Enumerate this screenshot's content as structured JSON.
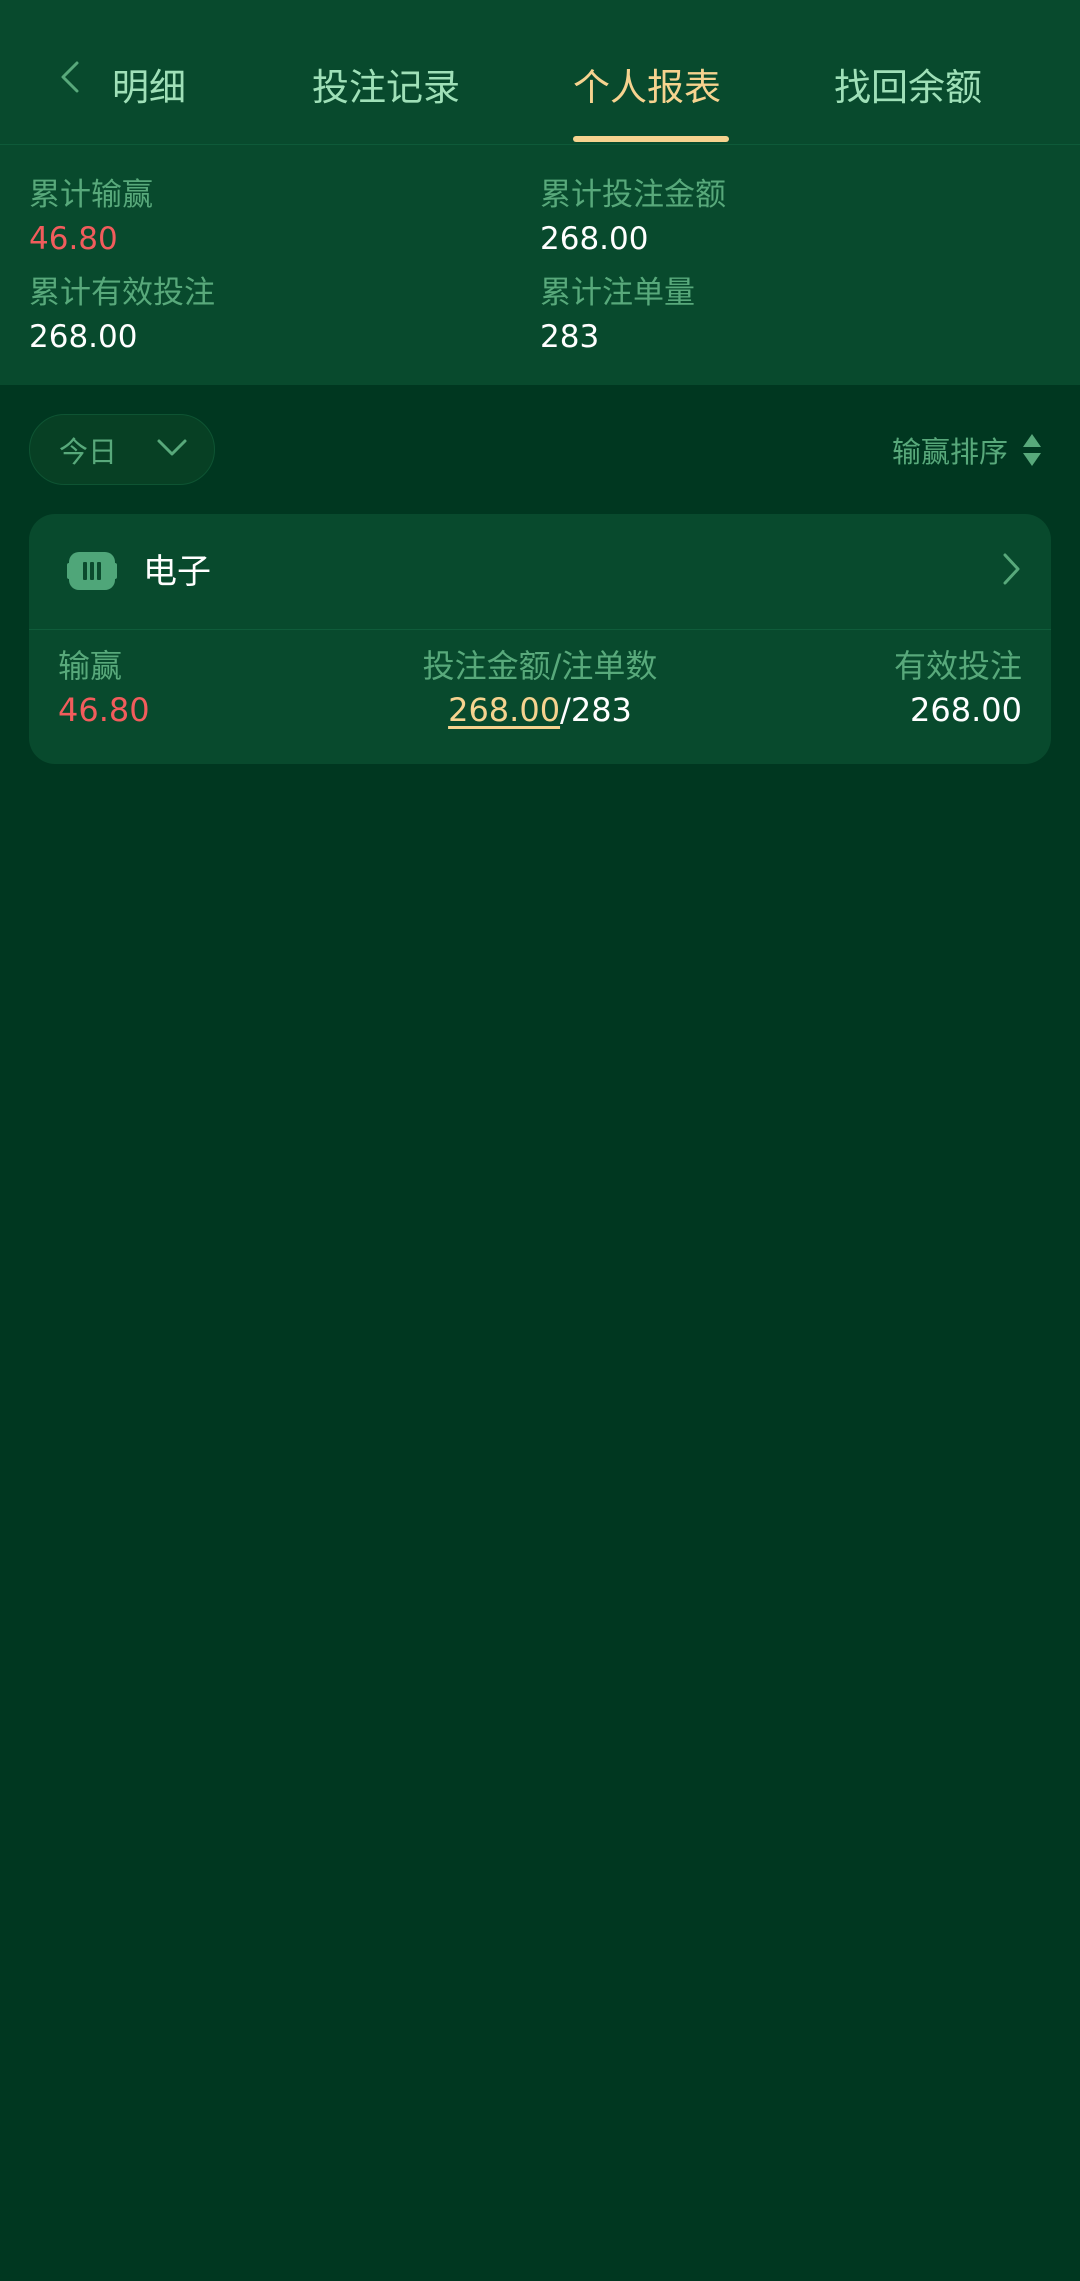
{
  "tabs": [
    {
      "label": "明细"
    },
    {
      "label": "投注记录"
    },
    {
      "label": "个人报表"
    },
    {
      "label": "找回余额"
    }
  ],
  "summary": {
    "total_winloss_label": "累计输赢",
    "total_winloss_value": "46.80",
    "total_bet_amount_label": "累计投注金额",
    "total_bet_amount_value": "268.00",
    "total_valid_bet_label": "累计有效投注",
    "total_valid_bet_value": "268.00",
    "total_bet_count_label": "累计注单量",
    "total_bet_count_value": "283"
  },
  "filter": {
    "selected": "今日"
  },
  "sort": {
    "label": "输赢排序"
  },
  "card": {
    "title": "电子",
    "winloss_label": "输赢",
    "winloss_value": "46.80",
    "amount_count_label": "投注金额/注单数",
    "amount_value": "268.00",
    "separator": "/",
    "count_value": "283",
    "valid_bet_label": "有效投注",
    "valid_bet_value": "268.00"
  },
  "colors": {
    "background": "#003720",
    "panel": "#084a2d",
    "accent": "#f6d38f",
    "label": "#58a97b",
    "negative": "#f25c5c"
  }
}
